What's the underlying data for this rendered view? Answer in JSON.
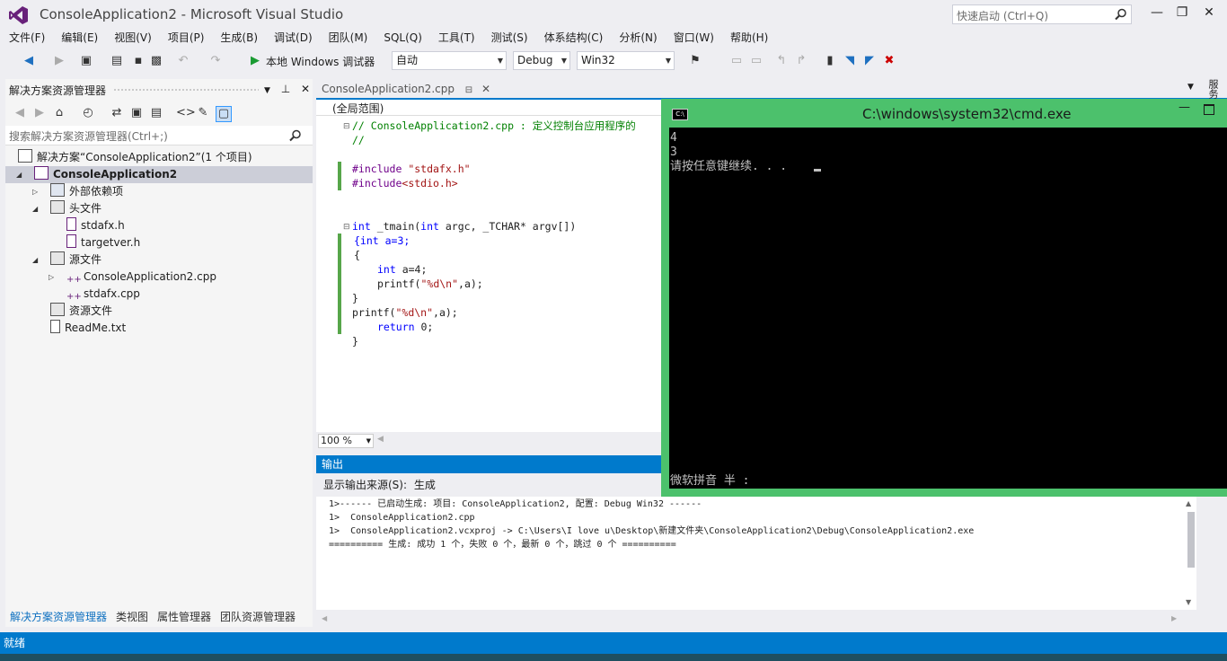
{
  "window": {
    "title": "ConsoleApplication2 - Microsoft Visual Studio",
    "quick_launch_placeholder": "快速启动 (Ctrl+Q)",
    "minimize": "—",
    "maximize": "❐",
    "close": "✕"
  },
  "menu": [
    "文件(F)",
    "编辑(E)",
    "视图(V)",
    "项目(P)",
    "生成(B)",
    "调试(D)",
    "团队(M)",
    "SQL(Q)",
    "工具(T)",
    "测试(S)",
    "体系结构(C)",
    "分析(N)",
    "窗口(W)",
    "帮助(H)"
  ],
  "toolbar": {
    "run_label": "本地 Windows 调试器",
    "auto_combo": "自动",
    "config_combo": "Debug",
    "platform_combo": "Win32"
  },
  "solution_explorer": {
    "title": "解决方案资源管理器",
    "search_placeholder": "搜索解决方案资源管理器(Ctrl+;)",
    "solution": "解决方案“ConsoleApplication2”(1 个项目)",
    "project": "ConsoleApplication2",
    "nodes": {
      "external_deps": "外部依赖项",
      "headers": "头文件",
      "stdafx_h": "stdafx.h",
      "targetver_h": "targetver.h",
      "sources": "源文件",
      "main_cpp": "ConsoleApplication2.cpp",
      "stdafx_cpp": "stdafx.cpp",
      "resources": "资源文件",
      "readme": "ReadMe.txt"
    },
    "tabs": [
      "解决方案资源管理器",
      "类视图",
      "属性管理器",
      "团队资源管理器"
    ]
  },
  "editor": {
    "tab_label": "ConsoleApplication2.cpp",
    "scope": "(全局范围)",
    "zoom": "100 %",
    "code": {
      "l1": "// ConsoleApplication2.cpp : 定义控制台应用程序的",
      "l2": "//",
      "l3a": "#include ",
      "l3b": "\"stdafx.h\"",
      "l4a": "#include",
      "l4b": "<stdio.h>",
      "l5a": "int",
      "l5b": " _tmain(",
      "l5c": "int",
      "l5d": " argc, _TCHAR* argv[])",
      "l6": "{int a=3;",
      "l7": "{",
      "l8a": "int",
      "l8b": " a=4;",
      "l9a": "printf(",
      "l9b": "\"%d\\n\"",
      "l9c": ",a);",
      "l10": "}",
      "l11a": "printf(",
      "l11b": "\"%d\\n\"",
      "l11c": ",a);",
      "l12a": "return",
      "l12b": " 0;",
      "l13": "}"
    }
  },
  "output": {
    "title": "输出",
    "source_label": "显示输出来源(S):",
    "source_value": "生成",
    "lines": [
      "1>------ 已启动生成: 项目: ConsoleApplication2, 配置: Debug Win32 ------",
      "1>  ConsoleApplication2.cpp",
      "1>  ConsoleApplication2.vcxproj -> C:\\Users\\I love u\\Desktop\\新建文件夹\\ConsoleApplication2\\Debug\\ConsoleApplication2.exe",
      "========== 生成: 成功 1 个，失败 0 个，最新 0 个，跳过 0 个 =========="
    ]
  },
  "cmd": {
    "title": "C:\\windows\\system32\\cmd.exe",
    "lines": [
      "4",
      "3",
      "请按任意键继续. . . "
    ],
    "ime": "微软拼音 半 :"
  },
  "status": {
    "text": "就绪"
  },
  "colors": {
    "accent": "#007acc",
    "cmd_frame": "#4cc16c"
  }
}
